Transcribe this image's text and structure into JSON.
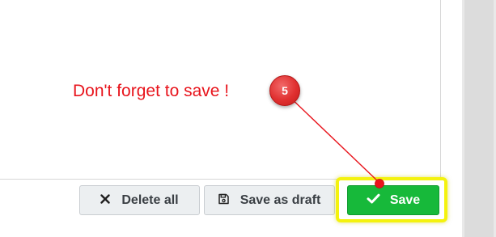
{
  "footer": {
    "delete_all_label": "Delete all",
    "delete_all_icon": "close-icon",
    "save_as_draft_label": "Save as draft",
    "save_as_draft_icon": "floppy-disk-icon",
    "save_label": "Save",
    "save_icon": "checkmark-icon"
  },
  "annotation": {
    "text": "Don't forget to save !",
    "step_number": "5",
    "color": "#e8141c",
    "highlight_color": "#f4f20d"
  },
  "colors": {
    "save_button": "#17b93a",
    "secondary_button": "#eceff1"
  }
}
